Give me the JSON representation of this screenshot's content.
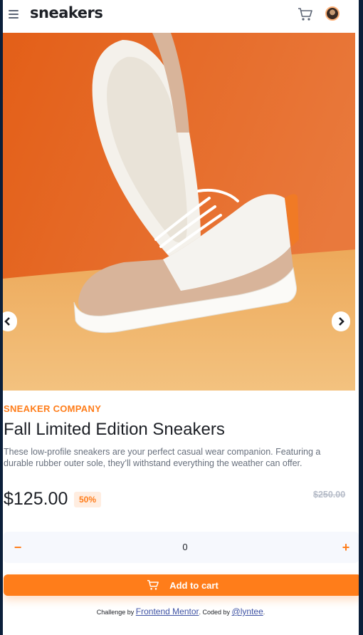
{
  "header": {
    "logo": "sneakers",
    "menu_icon": "hamburger-icon",
    "cart_icon": "cart-icon",
    "avatar_icon": "user-avatar"
  },
  "colors": {
    "accent": "#ff7d1a",
    "accent_pale": "#ffede0",
    "dark": "#1d2026",
    "text_muted": "#68707d",
    "hero_orange": "#e8722a",
    "hero_floor": "#f1b66f"
  },
  "gallery": {
    "prev_icon": "chevron-left-icon",
    "next_icon": "chevron-right-icon"
  },
  "product": {
    "company": "SNEAKER COMPANY",
    "title": "Fall Limited Edition Sneakers",
    "description": "These low-profile sneakers are your perfect casual wear companion. Featuring a durable rubber outer sole, they’ll withstand everything the weather can offer.",
    "price": "$125.00",
    "discount": "50%",
    "original_price": "$250.00"
  },
  "quantity": {
    "minus_label": "−",
    "value": "0",
    "plus_label": "+"
  },
  "cart_button": {
    "label": "Add to cart",
    "icon": "cart-icon"
  },
  "attribution": {
    "prefix": "Challenge by",
    "link1": "Frontend Mentor",
    "middle": ". Coded by",
    "link2": "@lyntee",
    "suffix": "."
  }
}
